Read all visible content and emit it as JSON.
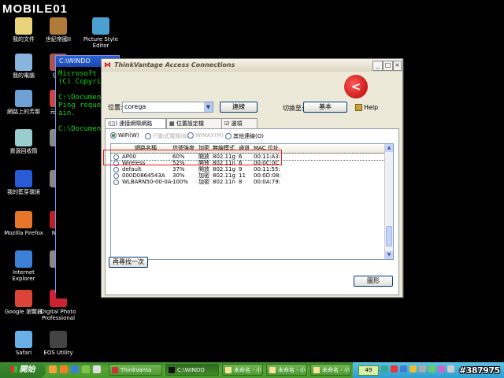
{
  "logo": "MOBILE01",
  "desktop_icons": [
    {
      "label": "我的文件",
      "label2": "",
      "color": "#e8d37a",
      "icon": "folder-icon"
    },
    {
      "label": "世紀帝國II",
      "label2": "",
      "color": "#b07a3a",
      "icon": "game-icon"
    },
    {
      "label": "Picture Style",
      "label2": "Editor",
      "color": "#4aa0d0",
      "icon": "picture-style-icon"
    },
    {
      "label": "我的電腦",
      "label2": "",
      "color": "#8ab4e0",
      "icon": "computer-icon"
    },
    {
      "label": "征服",
      "label2": "",
      "color": "#a55",
      "icon": "game-icon"
    },
    {
      "label": "網路上的芳鄰",
      "label2": "",
      "color": "#6fa0d8",
      "icon": "network-icon"
    },
    {
      "label": "元寶種",
      "label2": "",
      "color": "#c44",
      "icon": "app-icon"
    },
    {
      "label": "資源回收筒",
      "label2": "",
      "color": "#9cc",
      "icon": "recycle-bin-icon"
    },
    {
      "label": "Pa",
      "label2": "",
      "color": "#888",
      "icon": "app-icon"
    },
    {
      "label": "我的藍芽環境",
      "label2": "",
      "color": "#2a5bd6",
      "icon": "bluetooth-icon"
    },
    {
      "label": "Cl",
      "label2": "",
      "color": "#888",
      "icon": "app-icon"
    },
    {
      "label": "Mozilla Firefox",
      "label2": "",
      "color": "#e8762a",
      "icon": "firefox-icon"
    },
    {
      "label": "Nero",
      "label2": "R",
      "color": "#b22",
      "icon": "nero-icon"
    },
    {
      "label": "Internet",
      "label2": "Explorer",
      "color": "#3b7fd6",
      "icon": "ie-icon"
    },
    {
      "label": "Im",
      "label2": "",
      "color": "#888",
      "icon": "app-icon"
    },
    {
      "label": "Google 瀏覽器",
      "label2": "",
      "color": "#db4437",
      "icon": "chrome-icon"
    },
    {
      "label": "Digital Photo",
      "label2": "Professional",
      "color": "#c23",
      "icon": "dpp-icon"
    },
    {
      "label": "Safari",
      "label2": "",
      "color": "#6ab0e8",
      "icon": "safari-icon"
    },
    {
      "label": "EOS Utility",
      "label2": "",
      "color": "#444",
      "icon": "eos-icon"
    }
  ],
  "cmd": {
    "title": "C:\\WINDO",
    "lines": "Microsoft W\n(C) Copyrig\n\nC:\\Document\nPing reques\nain.\n\nC:\\Document"
  },
  "app": {
    "title": "ThinkVantage Access Connections",
    "brand_glyph": "<",
    "location_label": "位置:",
    "location_value": "corega",
    "connect_button": "連線",
    "switch_label": "切換至:",
    "switch_button": "基本",
    "help_label": "Help",
    "tabs": [
      "連接網際網路",
      "位置設定檔",
      "選項"
    ],
    "radios": [
      {
        "label": "WiFi(W)",
        "on": true,
        "dim": false
      },
      {
        "label": "行動式寬頻(B)",
        "on": false,
        "dim": true
      },
      {
        "label": "WiMAX(M)",
        "on": false,
        "dim": true
      },
      {
        "label": "其他連線(O)",
        "on": false,
        "dim": false
      }
    ],
    "columns": [
      "網路名稱",
      "信號強度",
      "加密",
      "無線模式",
      "通道",
      "MAC 位址"
    ],
    "rows": [
      [
        "AP00",
        "60%",
        "開放",
        "802.11g",
        "6",
        "00:11:A3:"
      ],
      [
        "Wireless",
        "52%",
        "開放",
        "802.11n",
        "6",
        "00:0C:0C"
      ],
      [
        "default",
        "37%",
        "開放",
        "802.11g",
        "9",
        "00:11:55:"
      ],
      [
        "000D0864543A",
        "30%",
        "加密",
        "802.11g",
        "11",
        "00:0D:08:"
      ],
      [
        "WLBARN50-00-0A-",
        "100%",
        "加密",
        "802.11n",
        "8",
        "00:0A:79:"
      ]
    ],
    "refresh_button": "再尋找一次",
    "legend_button": "圖形"
  },
  "taskbar": {
    "start_label": "開始",
    "tasks": [
      "ThinkVanta",
      "C:\\WINDO",
      "未命名 - 小",
      "未命名 - 小",
      "未命名 - 小"
    ],
    "battery": "49"
  },
  "watermark": "#387975"
}
